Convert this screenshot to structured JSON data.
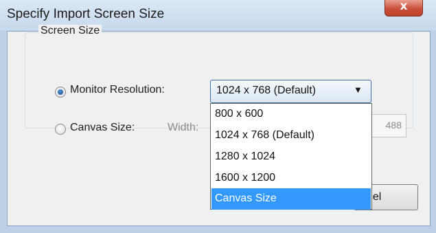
{
  "dialog": {
    "title": "Specify Import Screen Size",
    "close_glyph": "x",
    "close_icon": "close-icon"
  },
  "screen_size": {
    "group_label": "Screen Size",
    "monitor_resolution_label": "Monitor Resolution:",
    "monitor_resolution_checked": true,
    "canvas_size_label": "Canvas Size:",
    "canvas_size_checked": false,
    "width_label": "Width:",
    "width_value_visible": "488"
  },
  "resolution_select": {
    "value": "1024 x 768 (Default)",
    "options": [
      "800 x 600",
      "1024 x 768 (Default)",
      "1280 x 1024",
      "1600 x 1200",
      "Canvas Size"
    ],
    "highlighted_option": "Canvas Size"
  },
  "buttons": {
    "cancel_visible": "ncel"
  },
  "colors": {
    "highlight": "#3399ff",
    "close_button": "#c9503b"
  }
}
